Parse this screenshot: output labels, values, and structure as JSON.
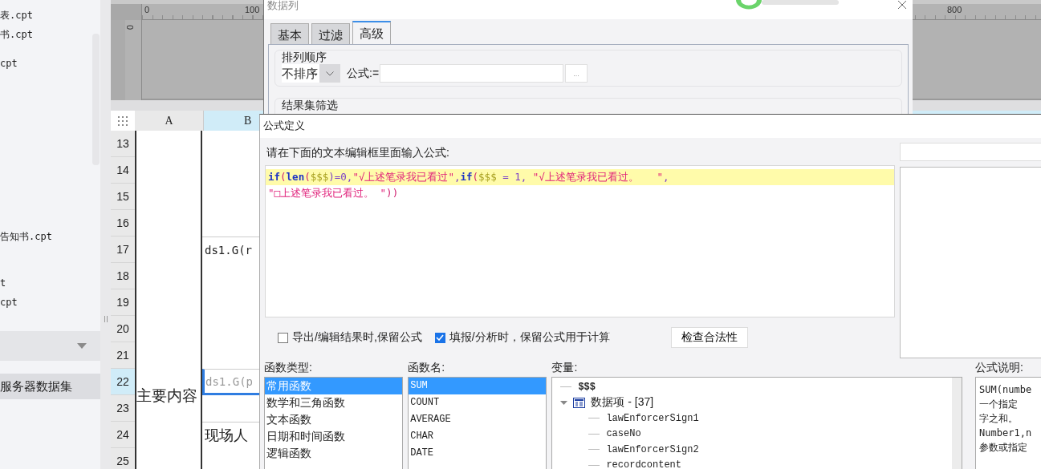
{
  "file_panel": {
    "files": [
      "表.cpt",
      "书.cpt",
      "cpt",
      "告知书.cpt",
      "t",
      "cpt"
    ],
    "datasets": [
      {
        "label": "服务器数据集",
        "selected": true
      }
    ]
  },
  "designer": {
    "ruler_labels": [
      "0",
      "100",
      "800"
    ],
    "vertical_ruler_label": "0",
    "columns": [
      {
        "label": "A",
        "selected": false
      },
      {
        "label": "B",
        "selected": true
      }
    ],
    "merged_cell_a": "主要内容",
    "rows": [
      {
        "number": "13",
        "selected": false
      },
      {
        "number": "14",
        "selected": false
      },
      {
        "number": "15",
        "selected": false
      },
      {
        "number": "16",
        "selected": false
      },
      {
        "number": "17",
        "selected": false,
        "cell_b": "ds1.G(r"
      },
      {
        "number": "18",
        "selected": false
      },
      {
        "number": "19",
        "selected": false
      },
      {
        "number": "20",
        "selected": false
      },
      {
        "number": "21",
        "selected": false
      },
      {
        "number": "22",
        "selected": true,
        "cell_b": "ds1.G(p"
      },
      {
        "number": "23",
        "selected": false
      },
      {
        "number": "24",
        "selected": false,
        "cell_b": "现场人"
      },
      {
        "number": "25",
        "selected": false
      }
    ]
  },
  "column_dialog": {
    "title": "数据列",
    "tabs": [
      {
        "label": "基本",
        "selected": false
      },
      {
        "label": "过滤",
        "selected": false
      },
      {
        "label": "高级",
        "selected": true
      }
    ],
    "sort_group": {
      "title": "排列顺序",
      "sort_select": "不排序",
      "formula_label": "公式:=",
      "browse_button": "..."
    },
    "filter_group": {
      "title": "结果集筛选"
    }
  },
  "formula_dialog": {
    "title": "公式定义",
    "prompt": "请在下面的文本编辑框里面输入公式:",
    "formula_lines": [
      [
        {
          "text": "if",
          "kind": "keyword"
        },
        {
          "text": "(",
          "kind": "punct"
        },
        {
          "text": "len",
          "kind": "keyword"
        },
        {
          "text": "(",
          "kind": "punct"
        },
        {
          "text": "$$$",
          "kind": "variable"
        },
        {
          "text": ")=0,",
          "kind": "number"
        },
        {
          "text": "\"√上述笔录我已看过\"",
          "kind": "string"
        },
        {
          "text": ",",
          "kind": "number"
        },
        {
          "text": "if",
          "kind": "keyword"
        },
        {
          "text": "(",
          "kind": "punct"
        },
        {
          "text": "$$$",
          "kind": "variable"
        },
        {
          "text": " = 1, ",
          "kind": "number"
        },
        {
          "text": "\"√上述笔录我已看过。   \"",
          "kind": "string"
        },
        {
          "text": ",",
          "kind": "number"
        }
      ],
      [
        {
          "text": "\"□上述笔录我已看过。 \"",
          "kind": "string"
        },
        {
          "text": "))",
          "kind": "punct"
        }
      ]
    ],
    "options": [
      {
        "label": "导出/编辑结果时,保留公式",
        "checked": false
      },
      {
        "label": "填报/分析时，保留公式用于计算",
        "checked": true
      }
    ],
    "check_button": "检查合法性",
    "function_types": {
      "title": "函数类型:",
      "items": [
        {
          "label": "常用函数",
          "selected": true
        },
        {
          "label": "数学和三角函数",
          "selected": false
        },
        {
          "label": "文本函数",
          "selected": false
        },
        {
          "label": "日期和时间函数",
          "selected": false
        },
        {
          "label": "逻辑函数",
          "selected": false
        }
      ]
    },
    "function_names": {
      "title": "函数名:",
      "items": [
        {
          "label": "SUM",
          "selected": true
        },
        {
          "label": "COUNT",
          "selected": false
        },
        {
          "label": "AVERAGE",
          "selected": false
        },
        {
          "label": "CHAR",
          "selected": false
        },
        {
          "label": "DATE",
          "selected": false
        }
      ]
    },
    "variables": {
      "title": "变量:",
      "items": [
        {
          "label": "$$$"
        },
        {
          "label": "数据项 - [37]",
          "expanded": true,
          "children": [
            {
              "label": "lawEnforcerSign1"
            },
            {
              "label": "caseNo"
            },
            {
              "label": "lawEnforcerSign2"
            },
            {
              "label": "recordcontent"
            }
          ]
        }
      ]
    },
    "description": {
      "title": "公式说明:",
      "lines": [
        "SUM(numbe",
        "一个指定",
        "字之和。",
        "Number1,n",
        "参数或指定"
      ]
    }
  }
}
